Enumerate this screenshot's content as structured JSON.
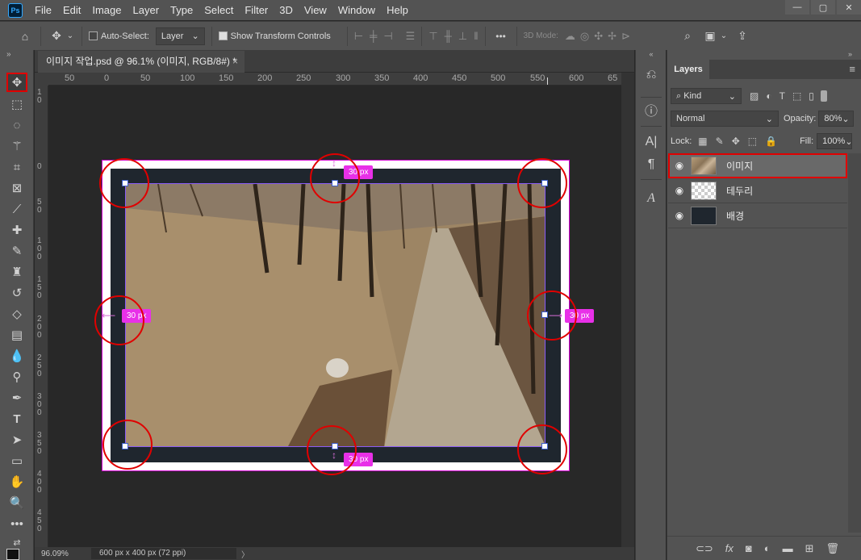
{
  "app": {
    "logo": "Ps"
  },
  "menu": [
    "File",
    "Edit",
    "Image",
    "Layer",
    "Type",
    "Select",
    "Filter",
    "3D",
    "View",
    "Window",
    "Help"
  ],
  "window_controls": {
    "minimize": "—",
    "maximize": "▢",
    "close": "✕"
  },
  "options_bar": {
    "auto_select_label": "Auto-Select:",
    "auto_select_value": "Layer",
    "show_transform_label": "Show Transform Controls",
    "three_d_mode_label": "3D Mode:",
    "more": "•••"
  },
  "document": {
    "tab_title": "이미지 작업.psd @ 96.1% (이미지, RGB/8#) *",
    "zoom": "96.09%",
    "size_info": "600 px x 400 px (72 ppi)",
    "status_arrow": "〉"
  },
  "ruler": {
    "top_labels": [
      "50",
      "0",
      "50",
      "100",
      "150",
      "200",
      "250",
      "300",
      "350",
      "400",
      "450",
      "500",
      "550",
      "600",
      "65"
    ],
    "left_labels": [
      "1 0",
      "0",
      "5 0",
      "1 0 0",
      "1 5 0",
      "2 0 0",
      "2 5 0",
      "3 0 0",
      "3 5 0",
      "4 0 0",
      "4 5 0"
    ]
  },
  "canvas": {
    "margin_tags": {
      "top": "30 px",
      "left": "30 px",
      "right": "30 px",
      "bottom": "30 px"
    }
  },
  "layers_panel": {
    "tab_label": "Layers",
    "kind_label": "Kind",
    "blend_mode": "Normal",
    "opacity_label": "Opacity:",
    "opacity_value": "80%",
    "lock_label": "Lock:",
    "fill_label": "Fill:",
    "fill_value": "100%",
    "layers": [
      {
        "name": "이미지",
        "selected": true
      },
      {
        "name": "테두리",
        "selected": false
      },
      {
        "name": "배경",
        "selected": false
      }
    ]
  },
  "colors": {
    "accent": "#e00000",
    "magenta_tag": "#e830e8",
    "frame": "#1f262e"
  }
}
